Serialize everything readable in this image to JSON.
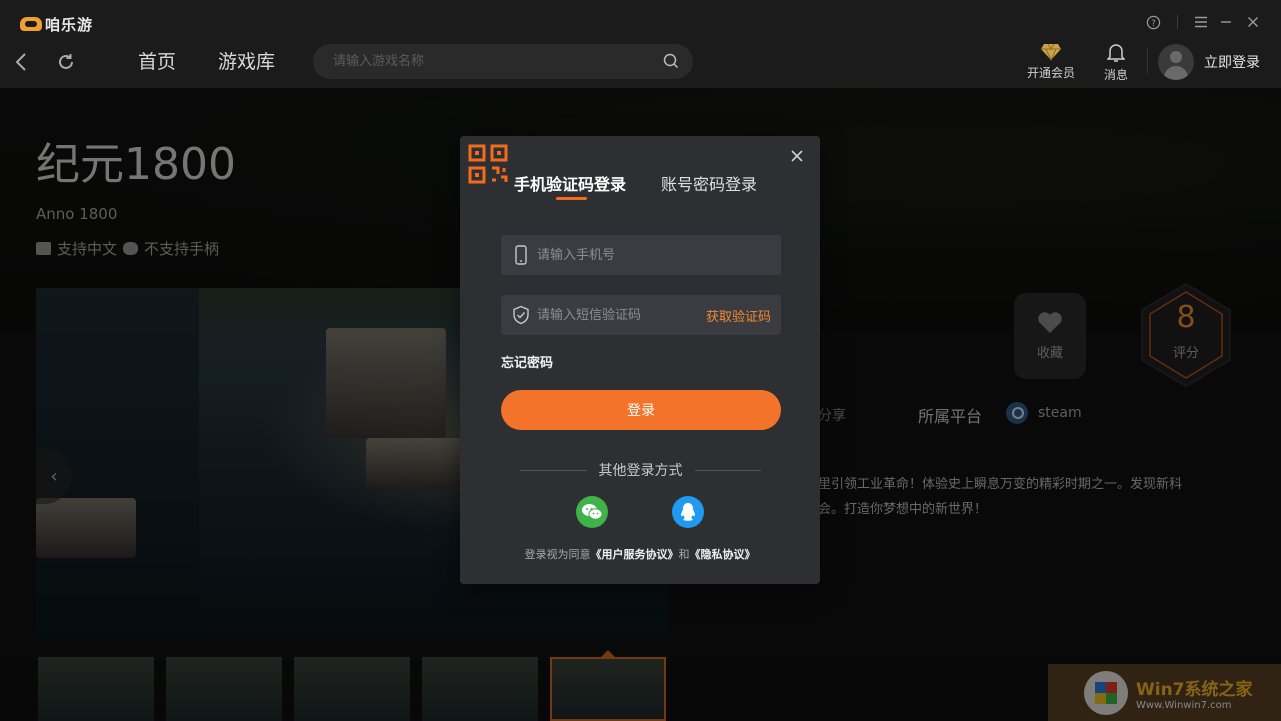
{
  "app": {
    "name": "咱乐游"
  },
  "window_controls": {
    "help": "?",
    "menu": "≡",
    "minimize": "—",
    "close": "✕"
  },
  "nav": {
    "back": "‹",
    "refresh": "↻",
    "links": [
      "首页",
      "游戏库"
    ],
    "search_placeholder": "请输入游戏名称"
  },
  "top_actions": {
    "vip": "开通会员",
    "messages": "消息",
    "login": "立即登录"
  },
  "game": {
    "title": "纪元1800",
    "subtitle": "Anno 1800",
    "tag_lang": "支持中文",
    "tag_controller": "不支持手柄",
    "favorite": "收藏",
    "score": "8",
    "score_label": "评分",
    "share": "分享",
    "platform_label": "所属平台",
    "platform": "steam",
    "desc_line1": "里引领工业革命！体验史上瞬息万变的精彩时期之一。发现新科",
    "desc_line2": "会。打造你梦想中的新世界！"
  },
  "watermark": {
    "text": "Win7系统之家",
    "url": "Www.Winwin7.com"
  },
  "modal": {
    "tab_sms": "手机验证码登录",
    "tab_password": "账号密码登录",
    "phone_placeholder": "请输入手机号",
    "code_placeholder": "请输入短信验证码",
    "get_code": "获取验证码",
    "forgot": "忘记密码",
    "login_button": "登录",
    "other_methods": "其他登录方式",
    "agree_prefix": "登录视为同意",
    "agree_terms": "《用户服务协议》",
    "agree_and": "和",
    "agree_privacy": "《隐私协议》"
  },
  "colors": {
    "accent": "#f3732a",
    "wechat": "#3fb24a",
    "qq": "#1f9af0",
    "score": "#f08a2c"
  }
}
